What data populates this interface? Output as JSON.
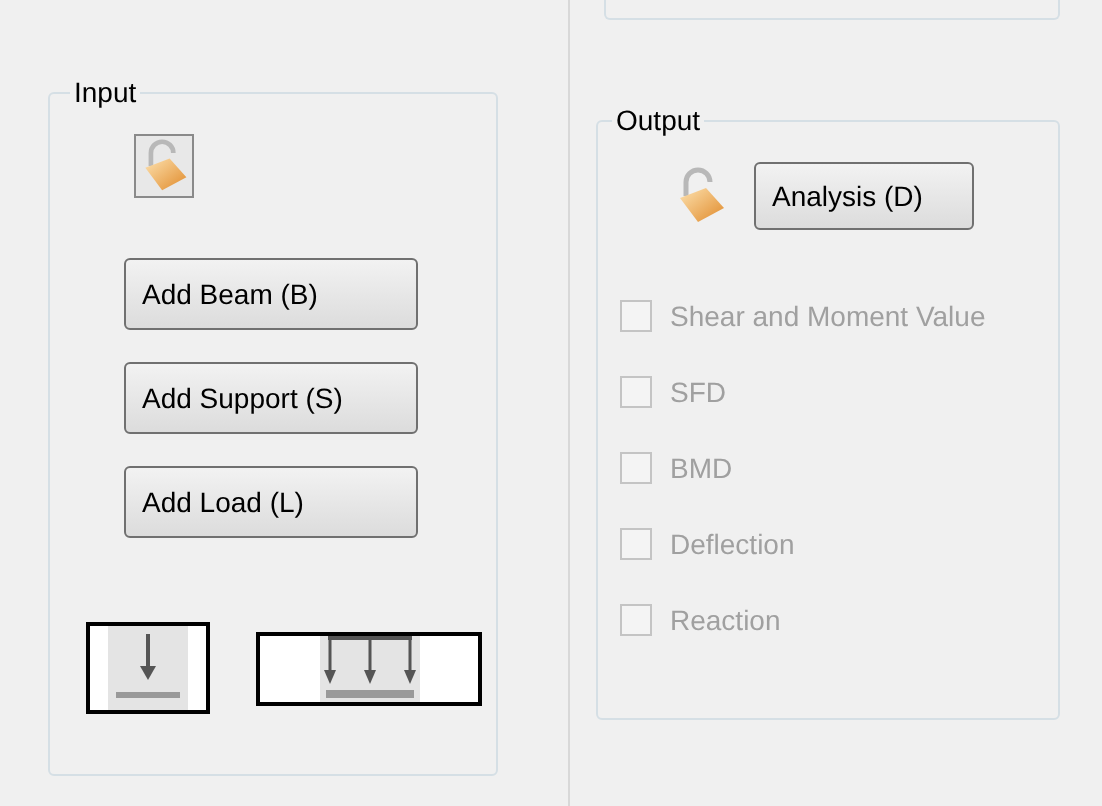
{
  "input_group": {
    "title": "Input",
    "buttons": [
      "Add Beam (B)",
      "Add Support (S)",
      "Add Load (L)"
    ]
  },
  "output_group": {
    "title": "Output",
    "analysis_button": "Analysis (D)",
    "checkboxes": [
      {
        "label": "Shear and Moment Value",
        "checked": false,
        "disabled": true
      },
      {
        "label": "SFD",
        "checked": false,
        "disabled": true
      },
      {
        "label": "BMD",
        "checked": false,
        "disabled": true
      },
      {
        "label": "Deflection",
        "checked": false,
        "disabled": true
      },
      {
        "label": "Reaction",
        "checked": false,
        "disabled": true
      }
    ]
  }
}
